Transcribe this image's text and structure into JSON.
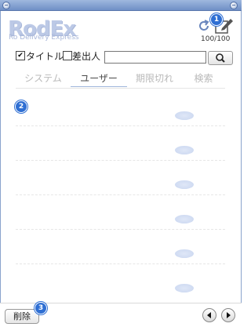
{
  "logo": {
    "name": "RodEx",
    "tagline": "Ro Delivery Express"
  },
  "header": {
    "count": "100/100"
  },
  "badges": {
    "one": "1",
    "two": "2",
    "three": "3"
  },
  "search": {
    "title_label": "タイトル",
    "title_checked": true,
    "sender_label": "差出人",
    "sender_checked": false,
    "input_value": ""
  },
  "tabs": [
    {
      "label": "システム"
    },
    {
      "label": "ユーザー"
    },
    {
      "label": "期限切れ"
    },
    {
      "label": "検索"
    }
  ],
  "active_tab": "ユーザー",
  "footer": {
    "delete_label": "削除"
  },
  "icons": {
    "refresh": "refresh-icon",
    "compose": "compose-icon",
    "search": "search-icon",
    "prev": "prev-arrow-icon",
    "next": "next-arrow-icon"
  },
  "colors": {
    "accent": "#2f6fd3",
    "logo": "#bcc9e6"
  }
}
